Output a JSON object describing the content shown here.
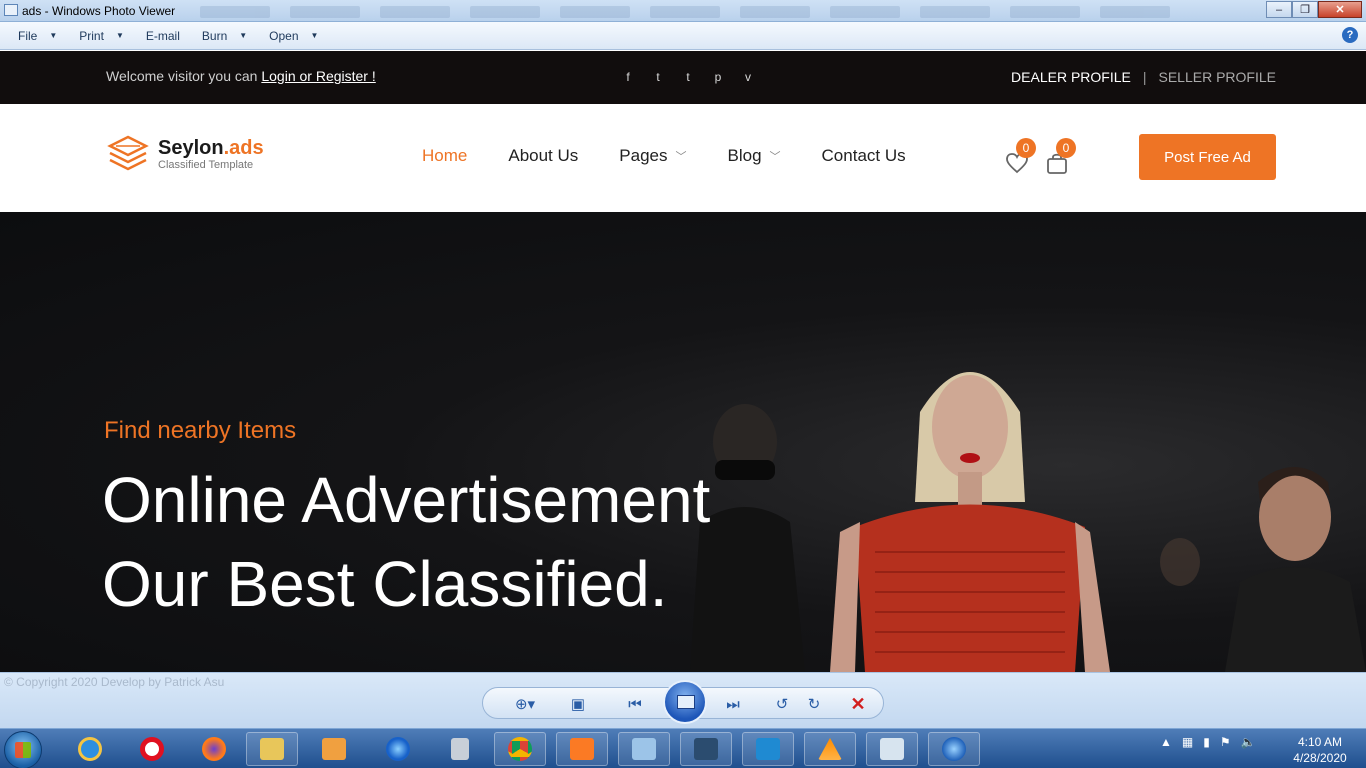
{
  "window": {
    "title": "ads - Windows Photo Viewer"
  },
  "menu": {
    "file": "File",
    "print": "Print",
    "email": "E-mail",
    "burn": "Burn",
    "open": "Open",
    "help_glyph": "?"
  },
  "topbar": {
    "welcome": "Welcome visitor you can ",
    "login_link": "Login or Register !",
    "social": [
      {
        "icon": "facebook-icon",
        "glyph": "f"
      },
      {
        "icon": "twitter-icon",
        "glyph": "t"
      },
      {
        "icon": "tumblr-icon",
        "glyph": "t"
      },
      {
        "icon": "pinterest-icon",
        "glyph": "p"
      },
      {
        "icon": "vimeo-icon",
        "glyph": "v"
      }
    ],
    "dealer_profile": "DEALER PROFILE",
    "separator": "|",
    "seller_profile": "SELLER PROFILE"
  },
  "brand": {
    "name_main": "Seylon",
    "name_accent": ".ads",
    "tagline": "Classified Template",
    "accent_color": "#ee7425"
  },
  "nav": {
    "items": [
      {
        "label": "Home",
        "active": true
      },
      {
        "label": "About Us"
      },
      {
        "label": "Pages",
        "dropdown": true
      },
      {
        "label": "Blog",
        "dropdown": true
      },
      {
        "label": "Contact Us"
      }
    ],
    "wishlist_count": "0",
    "cart_count": "0",
    "post_button": "Post Free Ad"
  },
  "hero": {
    "kicker": "Find nearby Items",
    "line1": "Online Advertisement",
    "line2": "Our Best Classified."
  },
  "viewer": {
    "copyright": "© Copyright 2020 Develop by Patrick Asu"
  },
  "taskbar": {
    "time": "4:10 AM",
    "date": "4/28/2020"
  }
}
